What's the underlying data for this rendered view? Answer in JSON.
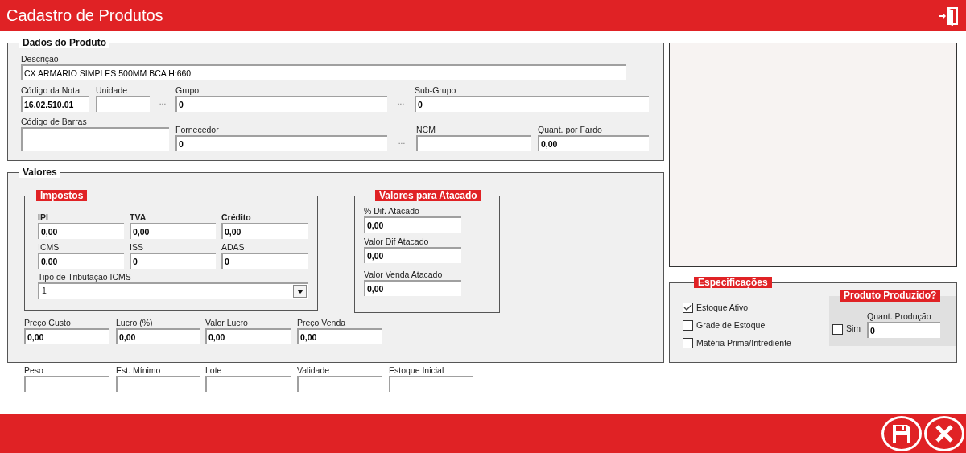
{
  "window": {
    "title": "Cadastro de Produtos"
  },
  "dados_do_produto": {
    "title": "Dados do Produto",
    "fields": [
      {
        "label": "Descrição",
        "value": "CX ARMARIO SIMPLES 500MM BCA H:660"
      },
      {
        "label": "Código da Nota",
        "value": "16.02.510.01"
      },
      {
        "label": "Unidade",
        "lookup": "..."
      },
      {
        "label": "Grupo",
        "value": "0",
        "lookup": "..."
      },
      {
        "label": "Sub-Grupo",
        "value": "0"
      },
      {
        "label": "Código de Barras"
      },
      {
        "label": "Fornecedor",
        "value": "0",
        "lookup": "..."
      },
      {
        "label": "NCM"
      },
      {
        "label": "Quant. por Fardo",
        "value": "0,00"
      }
    ]
  },
  "valores": {
    "title": "Valores",
    "impostos": {
      "title": "Impostos",
      "rows": [
        [
          {
            "label": "IPI",
            "value": "0,00",
            "bold": true
          },
          {
            "label": "TVA",
            "value": "0,00",
            "bold": true
          },
          {
            "label": "Crédito",
            "value": "0,00",
            "bold": true
          }
        ],
        [
          {
            "label": "ICMS",
            "value": "0,00",
            "bold": false
          },
          {
            "label": "ISS",
            "value": "0",
            "bold": false
          },
          {
            "label": "ADAS",
            "value": "0",
            "bold": false
          }
        ]
      ],
      "select": {
        "label": "Tipo de Tributação ICMS",
        "value": "1"
      }
    },
    "atacado": {
      "title": "Valores para Atacado",
      "fields": [
        {
          "label": "% Dif.  Atacado",
          "value": "0,00"
        },
        {
          "label": "Valor Dif Atacado",
          "value": "0,00"
        },
        {
          "label": "Valor Venda Atacado",
          "value": "0,00"
        }
      ]
    },
    "precos": [
      {
        "label": "Preço Custo",
        "value": "0,00"
      },
      {
        "label": "Lucro (%)",
        "value": "0,00"
      },
      {
        "label": "Valor Lucro",
        "value": "0,00"
      },
      {
        "label": "Preço Venda",
        "value": "0,00"
      }
    ]
  },
  "extra_fields": [
    {
      "label": "Peso"
    },
    {
      "label": "Est. Mínimo"
    },
    {
      "label": "Lote"
    },
    {
      "label": "Validade"
    },
    {
      "label": "Estoque Inicial"
    }
  ],
  "especificacoes": {
    "title": "Especificações",
    "options": [
      {
        "label": "Estoque Ativo",
        "checked": true
      },
      {
        "label": "Grade de Estoque",
        "checked": false
      },
      {
        "label": "Matéria Prima/Intrediente",
        "checked": false
      }
    ],
    "produzido": {
      "title": "Produto Produzido?",
      "option": {
        "label": "Sim",
        "checked": false
      },
      "field": {
        "label": "Quant. Produção",
        "value": "0"
      }
    }
  }
}
